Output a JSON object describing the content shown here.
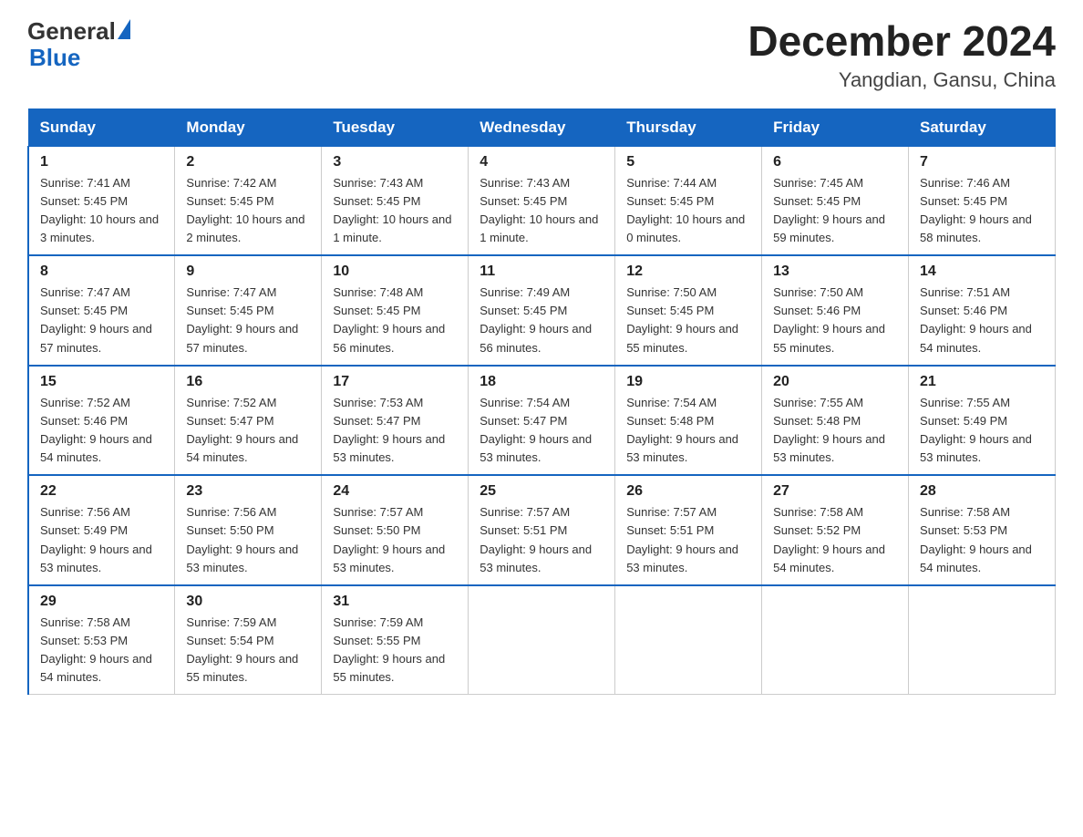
{
  "header": {
    "logo_general": "General",
    "logo_blue": "Blue",
    "month_year": "December 2024",
    "location": "Yangdian, Gansu, China"
  },
  "weekdays": [
    "Sunday",
    "Monday",
    "Tuesday",
    "Wednesday",
    "Thursday",
    "Friday",
    "Saturday"
  ],
  "weeks": [
    [
      {
        "day": "1",
        "sunrise": "7:41 AM",
        "sunset": "5:45 PM",
        "daylight": "10 hours and 3 minutes."
      },
      {
        "day": "2",
        "sunrise": "7:42 AM",
        "sunset": "5:45 PM",
        "daylight": "10 hours and 2 minutes."
      },
      {
        "day": "3",
        "sunrise": "7:43 AM",
        "sunset": "5:45 PM",
        "daylight": "10 hours and 1 minute."
      },
      {
        "day": "4",
        "sunrise": "7:43 AM",
        "sunset": "5:45 PM",
        "daylight": "10 hours and 1 minute."
      },
      {
        "day": "5",
        "sunrise": "7:44 AM",
        "sunset": "5:45 PM",
        "daylight": "10 hours and 0 minutes."
      },
      {
        "day": "6",
        "sunrise": "7:45 AM",
        "sunset": "5:45 PM",
        "daylight": "9 hours and 59 minutes."
      },
      {
        "day": "7",
        "sunrise": "7:46 AM",
        "sunset": "5:45 PM",
        "daylight": "9 hours and 58 minutes."
      }
    ],
    [
      {
        "day": "8",
        "sunrise": "7:47 AM",
        "sunset": "5:45 PM",
        "daylight": "9 hours and 57 minutes."
      },
      {
        "day": "9",
        "sunrise": "7:47 AM",
        "sunset": "5:45 PM",
        "daylight": "9 hours and 57 minutes."
      },
      {
        "day": "10",
        "sunrise": "7:48 AM",
        "sunset": "5:45 PM",
        "daylight": "9 hours and 56 minutes."
      },
      {
        "day": "11",
        "sunrise": "7:49 AM",
        "sunset": "5:45 PM",
        "daylight": "9 hours and 56 minutes."
      },
      {
        "day": "12",
        "sunrise": "7:50 AM",
        "sunset": "5:45 PM",
        "daylight": "9 hours and 55 minutes."
      },
      {
        "day": "13",
        "sunrise": "7:50 AM",
        "sunset": "5:46 PM",
        "daylight": "9 hours and 55 minutes."
      },
      {
        "day": "14",
        "sunrise": "7:51 AM",
        "sunset": "5:46 PM",
        "daylight": "9 hours and 54 minutes."
      }
    ],
    [
      {
        "day": "15",
        "sunrise": "7:52 AM",
        "sunset": "5:46 PM",
        "daylight": "9 hours and 54 minutes."
      },
      {
        "day": "16",
        "sunrise": "7:52 AM",
        "sunset": "5:47 PM",
        "daylight": "9 hours and 54 minutes."
      },
      {
        "day": "17",
        "sunrise": "7:53 AM",
        "sunset": "5:47 PM",
        "daylight": "9 hours and 53 minutes."
      },
      {
        "day": "18",
        "sunrise": "7:54 AM",
        "sunset": "5:47 PM",
        "daylight": "9 hours and 53 minutes."
      },
      {
        "day": "19",
        "sunrise": "7:54 AM",
        "sunset": "5:48 PM",
        "daylight": "9 hours and 53 minutes."
      },
      {
        "day": "20",
        "sunrise": "7:55 AM",
        "sunset": "5:48 PM",
        "daylight": "9 hours and 53 minutes."
      },
      {
        "day": "21",
        "sunrise": "7:55 AM",
        "sunset": "5:49 PM",
        "daylight": "9 hours and 53 minutes."
      }
    ],
    [
      {
        "day": "22",
        "sunrise": "7:56 AM",
        "sunset": "5:49 PM",
        "daylight": "9 hours and 53 minutes."
      },
      {
        "day": "23",
        "sunrise": "7:56 AM",
        "sunset": "5:50 PM",
        "daylight": "9 hours and 53 minutes."
      },
      {
        "day": "24",
        "sunrise": "7:57 AM",
        "sunset": "5:50 PM",
        "daylight": "9 hours and 53 minutes."
      },
      {
        "day": "25",
        "sunrise": "7:57 AM",
        "sunset": "5:51 PM",
        "daylight": "9 hours and 53 minutes."
      },
      {
        "day": "26",
        "sunrise": "7:57 AM",
        "sunset": "5:51 PM",
        "daylight": "9 hours and 53 minutes."
      },
      {
        "day": "27",
        "sunrise": "7:58 AM",
        "sunset": "5:52 PM",
        "daylight": "9 hours and 54 minutes."
      },
      {
        "day": "28",
        "sunrise": "7:58 AM",
        "sunset": "5:53 PM",
        "daylight": "9 hours and 54 minutes."
      }
    ],
    [
      {
        "day": "29",
        "sunrise": "7:58 AM",
        "sunset": "5:53 PM",
        "daylight": "9 hours and 54 minutes."
      },
      {
        "day": "30",
        "sunrise": "7:59 AM",
        "sunset": "5:54 PM",
        "daylight": "9 hours and 55 minutes."
      },
      {
        "day": "31",
        "sunrise": "7:59 AM",
        "sunset": "5:55 PM",
        "daylight": "9 hours and 55 minutes."
      },
      null,
      null,
      null,
      null
    ]
  ]
}
